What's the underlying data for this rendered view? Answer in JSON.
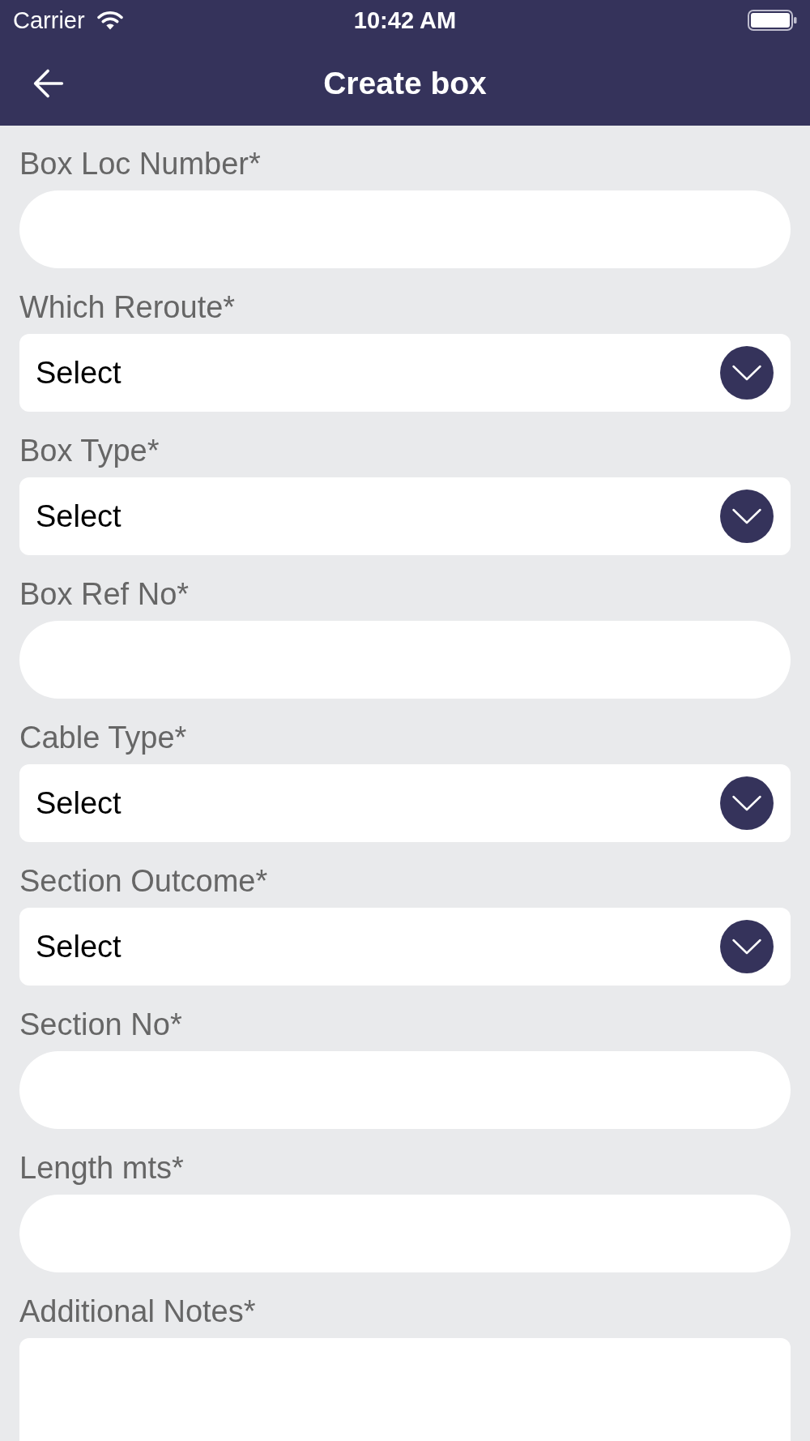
{
  "status_bar": {
    "carrier": "Carrier",
    "time": "10:42 AM"
  },
  "header": {
    "title": "Create box"
  },
  "form": {
    "fields": [
      {
        "kind": "text",
        "label": "Box Loc Number*"
      },
      {
        "kind": "select",
        "label": "Which Reroute*",
        "value": "Select"
      },
      {
        "kind": "select",
        "label": "Box Type*",
        "value": "Select"
      },
      {
        "kind": "text",
        "label": "Box Ref No*"
      },
      {
        "kind": "select",
        "label": "Cable Type*",
        "value": "Select"
      },
      {
        "kind": "select",
        "label": "Section Outcome*",
        "value": "Select"
      },
      {
        "kind": "text",
        "label": "Section No*"
      },
      {
        "kind": "text",
        "label": "Length mts*"
      },
      {
        "kind": "textarea",
        "label": "Additional Notes*"
      }
    ]
  }
}
